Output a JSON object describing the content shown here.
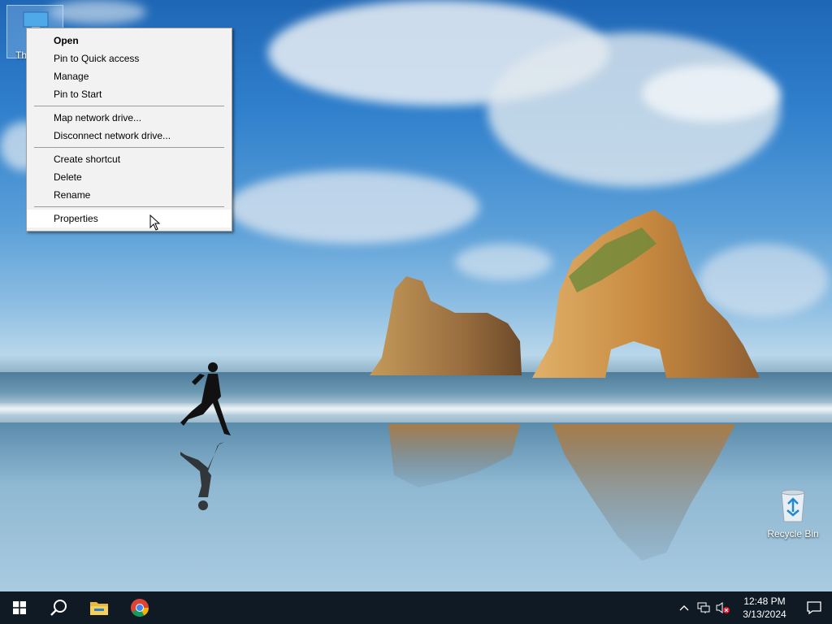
{
  "desktop": {
    "icons": {
      "this_pc_label": "Th",
      "recycle_bin_label": "Recycle Bin"
    }
  },
  "context_menu": {
    "groups": [
      [
        "Open",
        "Pin to Quick access",
        "Manage",
        "Pin to Start"
      ],
      [
        "Map network drive...",
        "Disconnect network drive..."
      ],
      [
        "Create shortcut",
        "Delete",
        "Rename"
      ],
      [
        "Properties"
      ]
    ],
    "default_item": "Open",
    "hovered_item": "Properties"
  },
  "taskbar": {
    "pinned": [
      "start-button",
      "search-icon",
      "file-explorer-icon",
      "chrome-icon"
    ],
    "tray": {
      "icons": [
        "chevron-up-icon",
        "network-icon",
        "volume-muted-icon"
      ],
      "time": "12:48 PM",
      "date": "3/13/2024",
      "notification_icon": "action-center-icon"
    }
  },
  "colors": {
    "taskbar_bg": "#0f1a25",
    "menu_bg": "#f2f2f2",
    "menu_border": "#a0a0a0",
    "accent_blue": "#2f7fcc"
  }
}
